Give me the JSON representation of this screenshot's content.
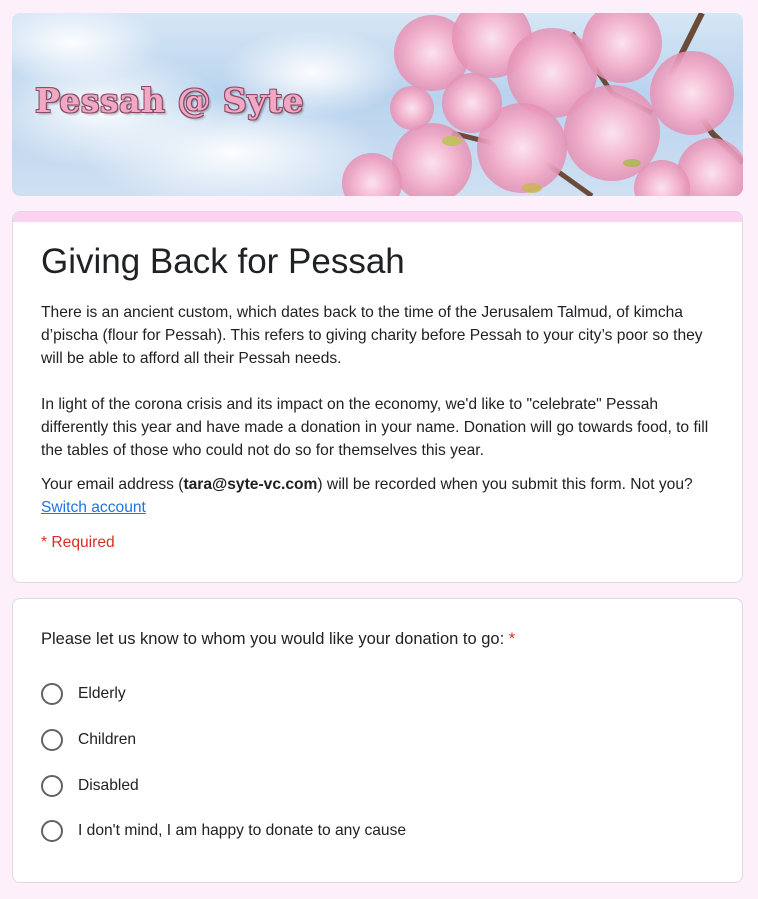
{
  "banner": {
    "title": "Pessah @ Syte"
  },
  "form": {
    "title": "Giving Back for Pessah",
    "description": [
      "There is an ancient custom, which dates back to the time of the Jerusalem Talmud, of kimcha d’pischa (flour for Pessah). This refers to giving charity before Pessah to your city’s poor so they will be able to afford all their Pessah needs.",
      "In light of the corona crisis and its impact on the economy, we'd like to \"celebrate\" Pessah differently this year and have made a donation in your name. Donation will go towards food, to fill the tables of those who could not do so for themselves this year."
    ],
    "email_prefix": "Your email address (",
    "email": "tara@syte-vc.com",
    "email_suffix": ") will be recorded when you submit this form. Not you? ",
    "switch_account": "Switch account",
    "required_note": "* Required"
  },
  "question": {
    "title": "Please let us know to whom you would like your donation to go:",
    "required_star": "*",
    "options": [
      "Elderly",
      "Children",
      "Disabled",
      "I don't mind, I am happy to donate to any cause"
    ]
  },
  "colors": {
    "page_background": "#fdf0fb",
    "header_accent": "#fbd3f1",
    "link": "#1a73e8",
    "required": "#d93025"
  }
}
